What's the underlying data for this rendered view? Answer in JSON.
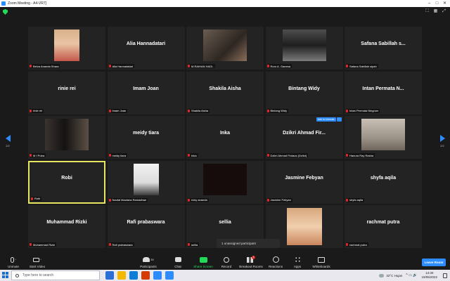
{
  "window": {
    "title": "Zoom Meeting - A4-VR7]",
    "controls": [
      "–",
      "□",
      "✕"
    ]
  },
  "meeting": {
    "page_left": "2/2",
    "page_right": "2/2",
    "view_controls": [
      "⛶",
      "▦",
      "⤢"
    ]
  },
  "participants": [
    {
      "display": "",
      "name": "Belva Ananda Shara",
      "muted": true,
      "photo": "portrait-girl"
    },
    {
      "display": "Alia Hannadatari",
      "name": "Alia Hannadatari",
      "muted": true
    },
    {
      "display": "",
      "name": "M.RAIHAN HADI..",
      "muted": true,
      "photo": "group-car"
    },
    {
      "display": "",
      "name": "Roro A. Ganesa",
      "muted": true,
      "photo": "dark-phone"
    },
    {
      "display": "Safana Sabillah s...",
      "name": "Safana Sabillah sipah",
      "muted": true
    },
    {
      "display": "rinie rei",
      "name": "rinie rei",
      "muted": true
    },
    {
      "display": "Imam Joan",
      "name": "Imam Joan",
      "muted": true
    },
    {
      "display": "Shakila Aisha",
      "name": "Shakila Aisha",
      "muted": true
    },
    {
      "display": "Bintang Widy",
      "name": "Bintang Widy",
      "muted": true
    },
    {
      "display": "Intan Permata N...",
      "name": "Intan Permata Ningrum",
      "muted": true
    },
    {
      "display": "",
      "name": "M I Putra",
      "muted": true,
      "photo": "mirror-selfie"
    },
    {
      "display": "meidy tiara",
      "name": "meidy tiara",
      "muted": true
    },
    {
      "display": "Inka",
      "name": "Inka",
      "muted": true
    },
    {
      "display": "Dzikri Ahmad Fir...",
      "name": "Dzikri Ahmad Firdaus (Dzikri)",
      "muted": true,
      "add_button": "Ask to Unmute",
      "more_button": "···"
    },
    {
      "display": "",
      "name": "Hanura Ray Rasha",
      "muted": true,
      "photo": "sitting-person"
    },
    {
      "display": "Robi",
      "name": "Robi",
      "muted": true,
      "active": true
    },
    {
      "display": "",
      "name": "Naufal Maulana Ramadhan",
      "muted": true,
      "photo": "illustration"
    },
    {
      "display": "",
      "name": "rizky ananda",
      "muted": true,
      "photo": "dark-video"
    },
    {
      "display": "Jasmine Febyan",
      "name": "Jasmine Febyan",
      "muted": true
    },
    {
      "display": "shyfa aqila",
      "name": "shyfa aqila",
      "muted": true
    },
    {
      "display": "Muhammad Rizki",
      "name": "Muhammad Rizki",
      "muted": true
    },
    {
      "display": "Rafi prabaswara",
      "name": "Rafi prabaswara",
      "muted": true
    },
    {
      "display": "sellia",
      "name": "sellia",
      "muted": true
    },
    {
      "display": "",
      "name": "",
      "muted": false,
      "photo": "girl-portrait"
    },
    {
      "display": "rachmat putra",
      "name": "rachmat putra",
      "muted": true
    }
  ],
  "unassigned": "1 unassigned participant",
  "toolbar": {
    "unmute": "Unmute",
    "start_video": "Start Video",
    "participants": "Participants",
    "participants_count": "30",
    "chat": "Chat",
    "share_screen": "Share Screen",
    "record": "Record",
    "breakout_rooms": "Breakout Rooms",
    "breakout_badge": "1",
    "reactions": "Reactions",
    "apps": "Apps",
    "whiteboards": "Whiteboards",
    "leave": "Leave Room"
  },
  "taskbar": {
    "search_placeholder": "Type here to search",
    "weather": "32°C Hujan",
    "time": "13:30",
    "date": "19/05/2022",
    "app_colors": [
      "#2b6fd6",
      "#f5b700",
      "#0f7cd6",
      "#d83b01",
      "#2d8cff",
      "#2d8cff"
    ]
  },
  "colors": {
    "accent": "#2d8cff",
    "muted_mic": "#e02828",
    "active_speaker": "#e6e661",
    "share_green": "#23d959"
  }
}
